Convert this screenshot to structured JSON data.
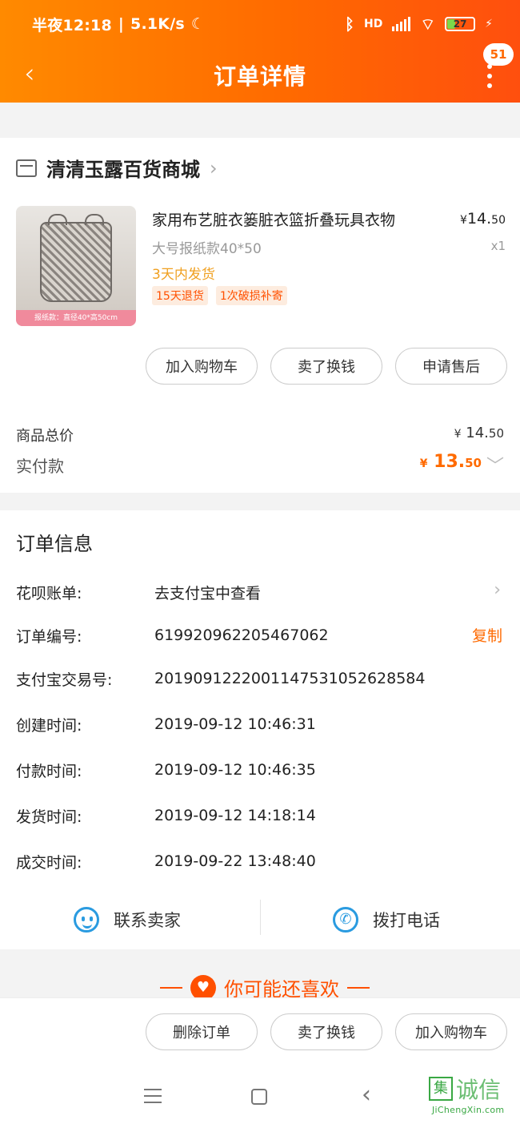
{
  "status_bar": {
    "time": "半夜12:18",
    "speed": "5.1K/s",
    "network_label": "HD",
    "battery": "27"
  },
  "header": {
    "title": "订单详情",
    "badge": "51"
  },
  "shop": {
    "name": "清清玉露百货商城"
  },
  "product": {
    "title": "家用布艺脏衣篓脏衣篮折叠玩具衣物",
    "spec": "大号报纸款40*50",
    "shipping": "3天内发货",
    "tags": [
      "15天退货",
      "1次破损补寄"
    ],
    "currency": "¥",
    "price_int": "14.",
    "price_dec": "50",
    "qty": "x1",
    "thumb_caption": "报纸款：直径40*高50cm"
  },
  "product_actions": {
    "add_cart": "加入购物车",
    "sell": "卖了换钱",
    "after_sale": "申请售后"
  },
  "summary": {
    "total_label": "商品总价",
    "total_int": "14.",
    "total_dec": "50",
    "paid_label": "实付款",
    "paid_int": "13.",
    "paid_dec": "50",
    "currency": "¥"
  },
  "order_info": {
    "title": "订单信息",
    "rows": [
      {
        "label": "花呗账单:",
        "value": "去支付宝中查看"
      },
      {
        "label": "订单编号:",
        "value": "619920962205467062"
      },
      {
        "label": "支付宝交易号:",
        "value": "2019091222001147531052628584"
      },
      {
        "label": "创建时间:",
        "value": "2019-09-12 10:46:31"
      },
      {
        "label": "付款时间:",
        "value": "2019-09-12 10:46:35"
      },
      {
        "label": "发货时间:",
        "value": "2019-09-12 14:18:14"
      },
      {
        "label": "成交时间:",
        "value": "2019-09-22 13:48:40"
      }
    ],
    "copy": "复制"
  },
  "contact": {
    "seller": "联系卖家",
    "phone": "拨打电话"
  },
  "recommend": {
    "label": "你可能还喜欢"
  },
  "bottom_actions": {
    "delete": "删除订单",
    "sell": "卖了换钱",
    "add_cart": "加入购物车"
  },
  "watermark": {
    "text": "诚信",
    "box": "集",
    "sub": "JiChengXin.com"
  },
  "colors": {
    "accent": "#ff6a00",
    "price": "#ff6a00",
    "link_blue": "#2a9be0"
  }
}
